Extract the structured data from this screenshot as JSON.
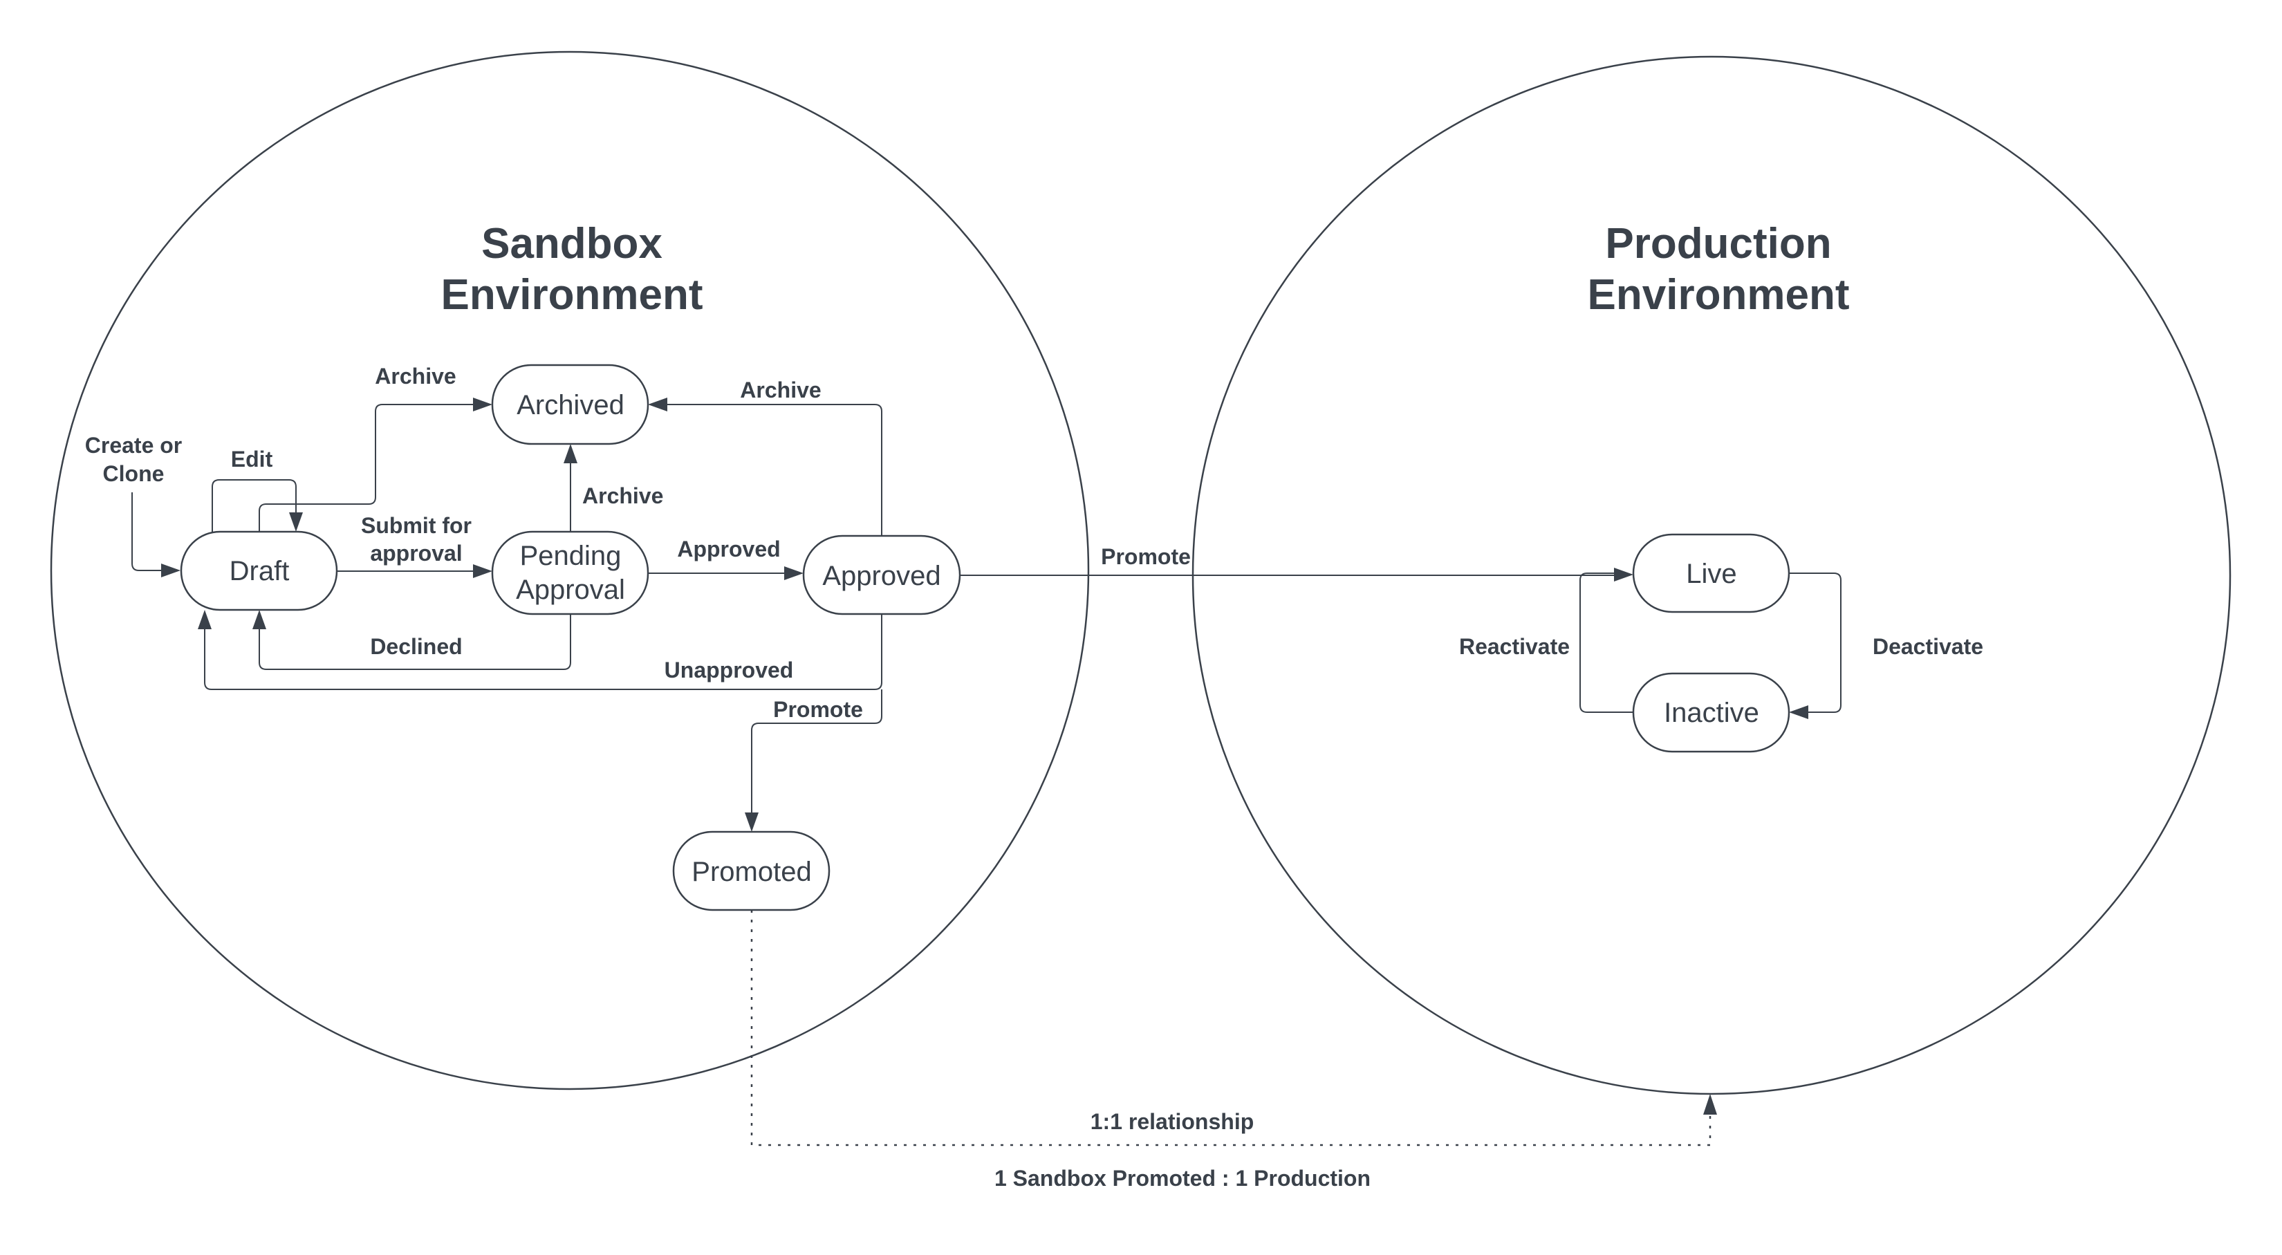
{
  "diagram": {
    "type": "state-diagram",
    "colors": {
      "ink": "#3a414a",
      "background": "#ffffff"
    },
    "environments": [
      {
        "id": "sandbox",
        "title_line1": "Sandbox",
        "title_line2": "Environment"
      },
      {
        "id": "production",
        "title_line1": "Production",
        "title_line2": "Environment"
      }
    ],
    "nodes": {
      "draft": "Draft",
      "archived": "Archived",
      "pending_line1": "Pending",
      "pending_line2": "Approval",
      "approved": "Approved",
      "promoted": "Promoted",
      "live": "Live",
      "inactive": "Inactive"
    },
    "edge_labels": {
      "create_line1": "Create or",
      "create_line2": "Clone",
      "edit": "Edit",
      "draft_archive": "Archive",
      "approved_archive": "Archive",
      "pending_archive": "Archive",
      "submit_line1": "Submit for",
      "submit_line2": "approval",
      "approved": "Approved",
      "declined": "Declined",
      "unapproved": "Unapproved",
      "promote_internal": "Promote",
      "promote_production": "Promote",
      "reactivate": "Reactivate",
      "deactivate": "Deactivate",
      "relationship": "1:1 relationship",
      "relationship_detail": "1 Sandbox Promoted : 1 Production"
    },
    "transitions": [
      {
        "from": "start",
        "to": "Draft",
        "label": "Create or Clone"
      },
      {
        "from": "Draft",
        "to": "Draft",
        "label": "Edit"
      },
      {
        "from": "Draft",
        "to": "Archived",
        "label": "Archive"
      },
      {
        "from": "Draft",
        "to": "Pending Approval",
        "label": "Submit for approval"
      },
      {
        "from": "Pending Approval",
        "to": "Archived",
        "label": "Archive"
      },
      {
        "from": "Pending Approval",
        "to": "Approved",
        "label": "Approved"
      },
      {
        "from": "Pending Approval",
        "to": "Draft",
        "label": "Declined"
      },
      {
        "from": "Approved",
        "to": "Archived",
        "label": "Archive"
      },
      {
        "from": "Approved",
        "to": "Draft",
        "label": "Unapproved"
      },
      {
        "from": "Approved",
        "to": "Promoted",
        "label": "Promote"
      },
      {
        "from": "Approved",
        "to": "Live",
        "label": "Promote"
      },
      {
        "from": "Live",
        "to": "Inactive",
        "label": "Deactivate"
      },
      {
        "from": "Inactive",
        "to": "Live",
        "label": "Reactivate"
      },
      {
        "from": "Promoted",
        "to": "Production Environment",
        "label": "1:1 relationship",
        "style": "dotted"
      }
    ]
  }
}
